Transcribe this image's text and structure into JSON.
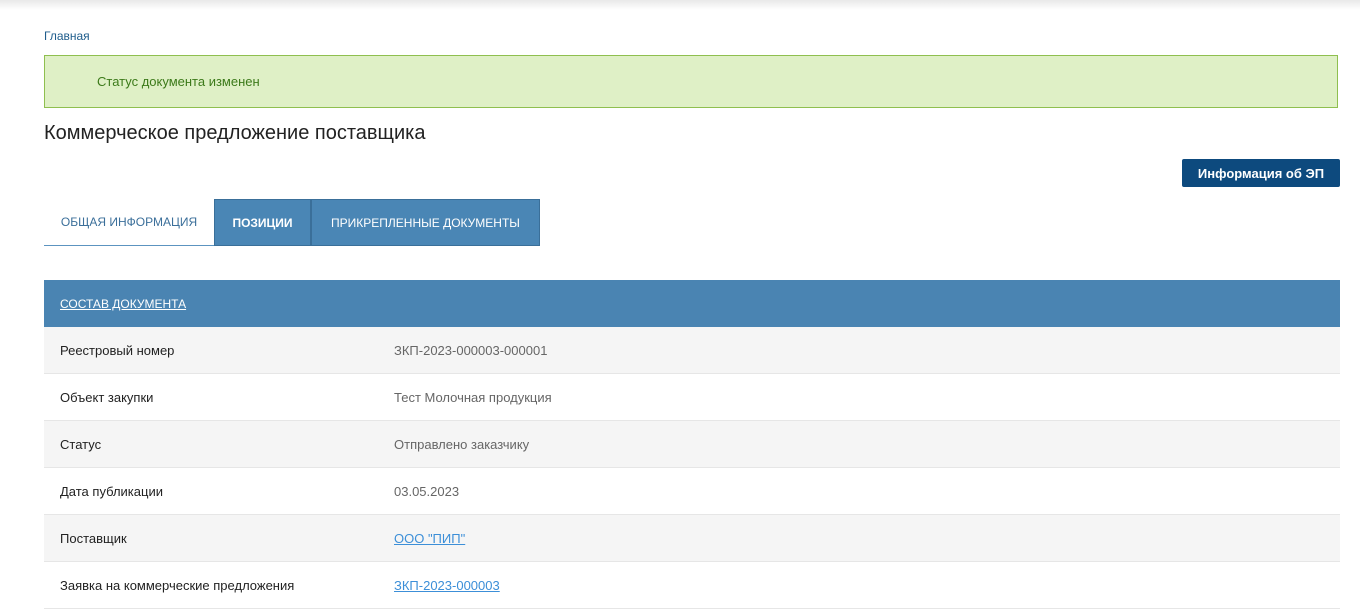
{
  "breadcrumb": {
    "home": "Главная"
  },
  "alert": {
    "message": "Статус документа изменен"
  },
  "page": {
    "title": "Коммерческое предложение поставщика"
  },
  "actions": {
    "ep_info_button": "Информация об ЭП"
  },
  "tabs": [
    {
      "label": "ОБЩАЯ ИНФОРМАЦИЯ",
      "active": true
    },
    {
      "label": "ПОЗИЦИИ",
      "active": false
    },
    {
      "label": "ПРИКРЕПЛЕННЫЕ ДОКУМЕНТЫ",
      "active": false
    }
  ],
  "section": {
    "title": "СОСТАВ ДОКУМЕНТА"
  },
  "rows": [
    {
      "label": "Реестровый номер",
      "value": "ЗКП-2023-000003-000001"
    },
    {
      "label": "Объект закупки",
      "value": "Тест Молочная продукция"
    },
    {
      "label": "Статус",
      "value": "Отправлено заказчику"
    },
    {
      "label": "Дата публикации",
      "value": "03.05.2023"
    },
    {
      "label": "Поставщик",
      "value": "ООО \"ПИП\""
    },
    {
      "label": "Заявка на коммерческие предложения",
      "value": "ЗКП-2023-000003"
    }
  ],
  "colors": {
    "primary_dark": "#0d4a7e",
    "tab_blue": "#4a86b5",
    "alert_bg": "#dff0c6",
    "alert_text": "#3c7a1a",
    "link": "#3c8fd8"
  }
}
